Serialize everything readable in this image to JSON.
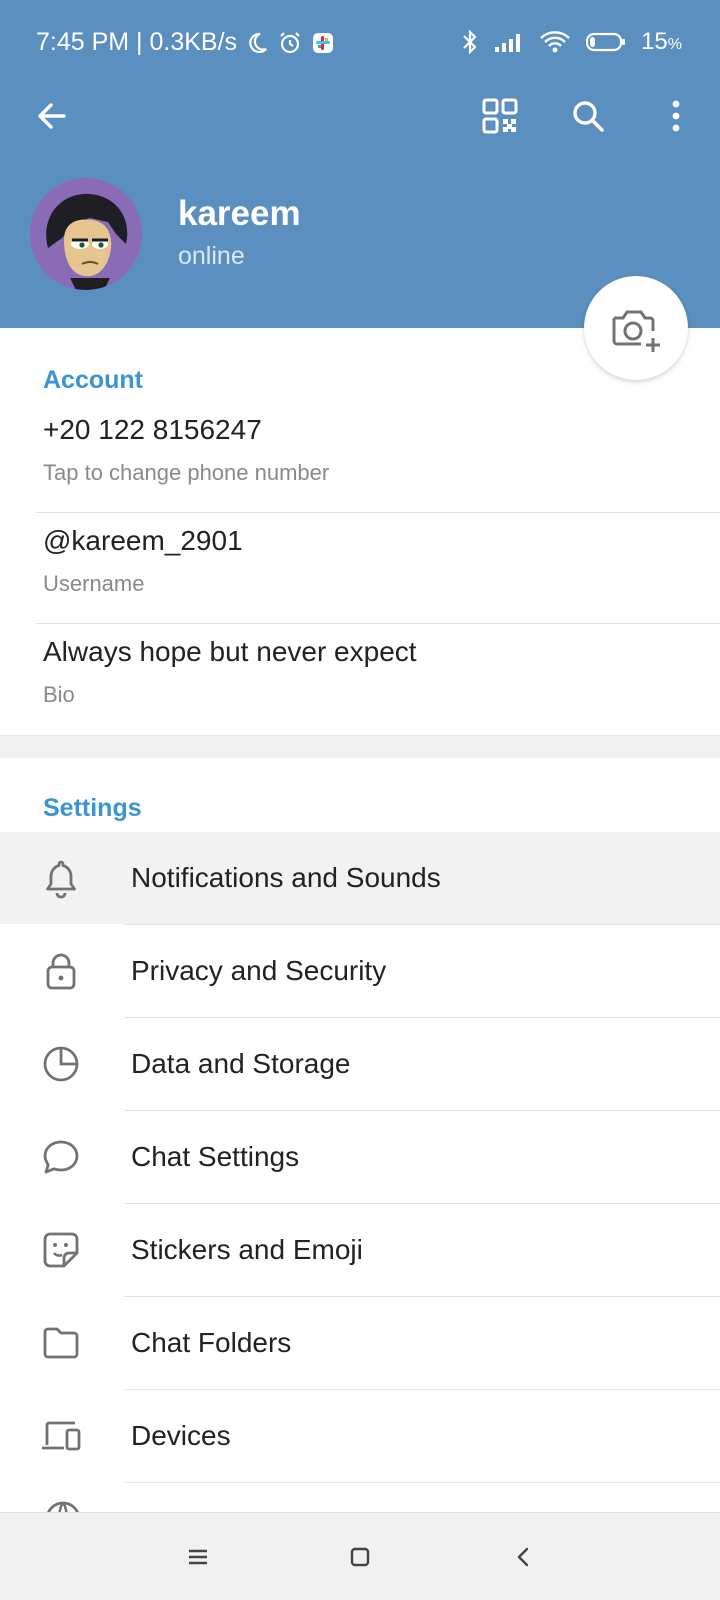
{
  "status_bar": {
    "time_speed": "7:45 PM | 0.3KB/s",
    "battery": "15",
    "battery_unit": "%"
  },
  "toolbar": {
    "back_icon": "arrow-left-icon",
    "qr_icon": "qr-code-icon",
    "search_icon": "search-icon",
    "more_icon": "more-vertical-icon"
  },
  "profile": {
    "name": "kareem",
    "status": "online"
  },
  "account": {
    "title": "Account",
    "phone": {
      "value": "+20 122 8156247",
      "label": "Tap to change phone number"
    },
    "username": {
      "value": "@kareem_2901",
      "label": "Username"
    },
    "bio": {
      "value": "Always hope but never expect",
      "label": "Bio"
    }
  },
  "settings": {
    "title": "Settings",
    "items": [
      {
        "label": "Notifications and Sounds",
        "icon": "bell-icon"
      },
      {
        "label": "Privacy and Security",
        "icon": "lock-icon"
      },
      {
        "label": "Data and Storage",
        "icon": "pie-chart-icon"
      },
      {
        "label": "Chat Settings",
        "icon": "chat-bubble-icon"
      },
      {
        "label": "Stickers and Emoji",
        "icon": "sticker-icon"
      },
      {
        "label": "Chat Folders",
        "icon": "folder-icon"
      },
      {
        "label": "Devices",
        "icon": "devices-icon"
      }
    ]
  },
  "colors": {
    "header": "#5b8fbf",
    "accent": "#3a95d0",
    "icon": "#6f7378"
  }
}
